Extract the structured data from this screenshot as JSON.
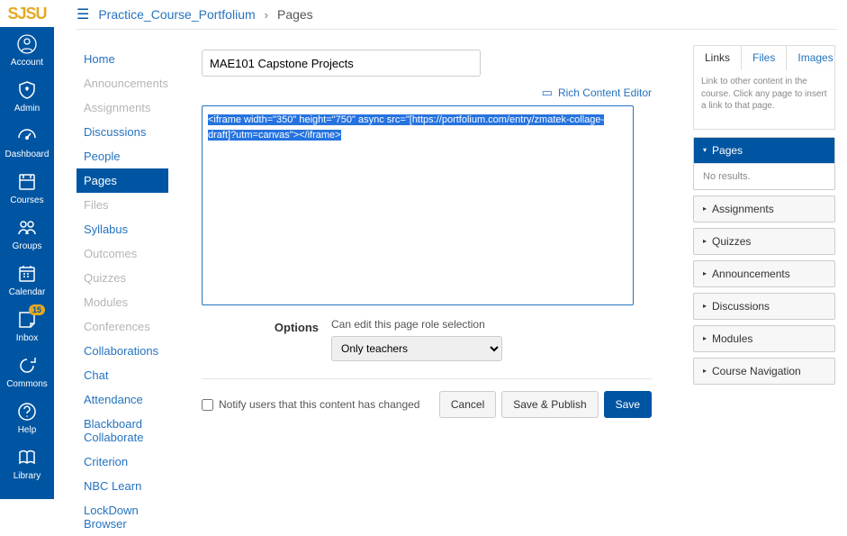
{
  "logo_text": "SJSU",
  "global_nav": [
    {
      "label": "Account"
    },
    {
      "label": "Admin"
    },
    {
      "label": "Dashboard"
    },
    {
      "label": "Courses"
    },
    {
      "label": "Groups"
    },
    {
      "label": "Calendar"
    },
    {
      "label": "Inbox",
      "badge": "15"
    },
    {
      "label": "Commons"
    },
    {
      "label": "Help"
    },
    {
      "label": "Library"
    }
  ],
  "breadcrumb": {
    "course": "Practice_Course_Portfolium",
    "current": "Pages"
  },
  "course_nav": [
    {
      "label": "Home",
      "state": "link"
    },
    {
      "label": "Announcements",
      "state": "disabled"
    },
    {
      "label": "Assignments",
      "state": "disabled"
    },
    {
      "label": "Discussions",
      "state": "link"
    },
    {
      "label": "People",
      "state": "link"
    },
    {
      "label": "Pages",
      "state": "active"
    },
    {
      "label": "Files",
      "state": "disabled"
    },
    {
      "label": "Syllabus",
      "state": "link"
    },
    {
      "label": "Outcomes",
      "state": "disabled"
    },
    {
      "label": "Quizzes",
      "state": "disabled"
    },
    {
      "label": "Modules",
      "state": "disabled"
    },
    {
      "label": "Conferences",
      "state": "disabled"
    },
    {
      "label": "Collaborations",
      "state": "link"
    },
    {
      "label": "Chat",
      "state": "link"
    },
    {
      "label": "Attendance",
      "state": "link"
    },
    {
      "label": "Blackboard Collaborate",
      "state": "link"
    },
    {
      "label": "Criterion",
      "state": "link"
    },
    {
      "label": "NBC Learn",
      "state": "link"
    },
    {
      "label": "LockDown Browser",
      "state": "link"
    }
  ],
  "page": {
    "title_value": "MAE101 Capstone Projects",
    "rce_link": "Rich Content Editor",
    "editor_html": "<iframe width=\"350\" height=\"750\" async src=\"[https://portfolium.com/entry/zmatek-collage-draft]?utm=canvas\"></iframe>",
    "options_label": "Options",
    "role_hint": "Can edit this page role selection",
    "role_value": "Only teachers",
    "notify_label": "Notify users that this content has changed",
    "cancel": "Cancel",
    "save_publish": "Save & Publish",
    "save": "Save"
  },
  "sidebar": {
    "tabs": [
      "Links",
      "Files",
      "Images"
    ],
    "instructions": "Link to other content in the course. Click any page to insert a link to that page.",
    "sections": [
      {
        "label": "Pages",
        "open": true,
        "body": "No results."
      },
      {
        "label": "Assignments"
      },
      {
        "label": "Quizzes"
      },
      {
        "label": "Announcements"
      },
      {
        "label": "Discussions"
      },
      {
        "label": "Modules"
      },
      {
        "label": "Course Navigation"
      }
    ]
  }
}
